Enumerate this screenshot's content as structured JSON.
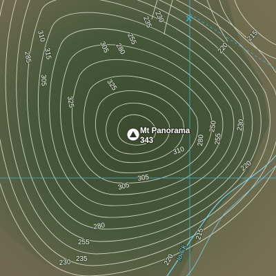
{
  "map": {
    "peak": {
      "name": "Mt Panorama",
      "elevation": "343",
      "icon": "peak-triangle-icon"
    },
    "creek_label": "lo Ck",
    "contour_labels": [
      "230",
      "235",
      "255",
      "280",
      "305",
      "325",
      "315",
      "310",
      "305",
      "285",
      "220",
      "215",
      "230",
      "220",
      "250",
      "255",
      "280",
      "310",
      "325",
      "305",
      "280",
      "255",
      "230",
      "235",
      "220",
      "215",
      "305"
    ],
    "colors": {
      "terrain": "#4a5a3c",
      "contour": "#e8e8dc",
      "grid_line": "#37b8d8",
      "creek": "#7fd8f0",
      "peak_marker": "#ffffff"
    }
  }
}
